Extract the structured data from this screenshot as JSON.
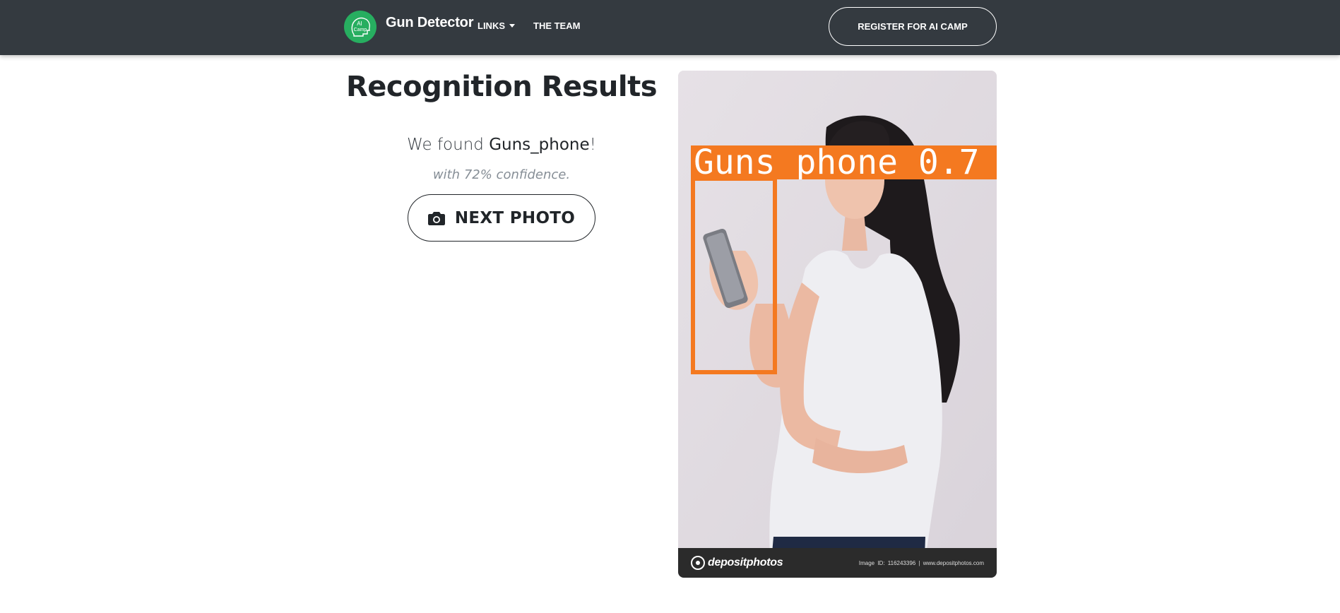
{
  "navbar": {
    "brand_name": "Gun Detector",
    "logo_text_top": "AI",
    "logo_text_bottom": "Camp",
    "links_label": "LINKS",
    "team_label": "THE TEAM",
    "register_label": "REGISTER FOR AI CAMP",
    "background_color": "#343a40",
    "logo_color": "#27ae60"
  },
  "results": {
    "title": "Recognition Results",
    "found_prefix": "We found ",
    "detected_class": "Guns_phone",
    "found_suffix": "!",
    "confidence_text": "with 72% confidence.",
    "next_button_label": "NEXT PHOTO",
    "next_button_icon": "camera-icon"
  },
  "photo": {
    "detection_label": "Guns_phone 0.7",
    "detection_color": "#f47920",
    "watermark_brand": "depositphotos",
    "watermark_meta": "Image ID: 116243396 | www.depositphotos.com"
  }
}
